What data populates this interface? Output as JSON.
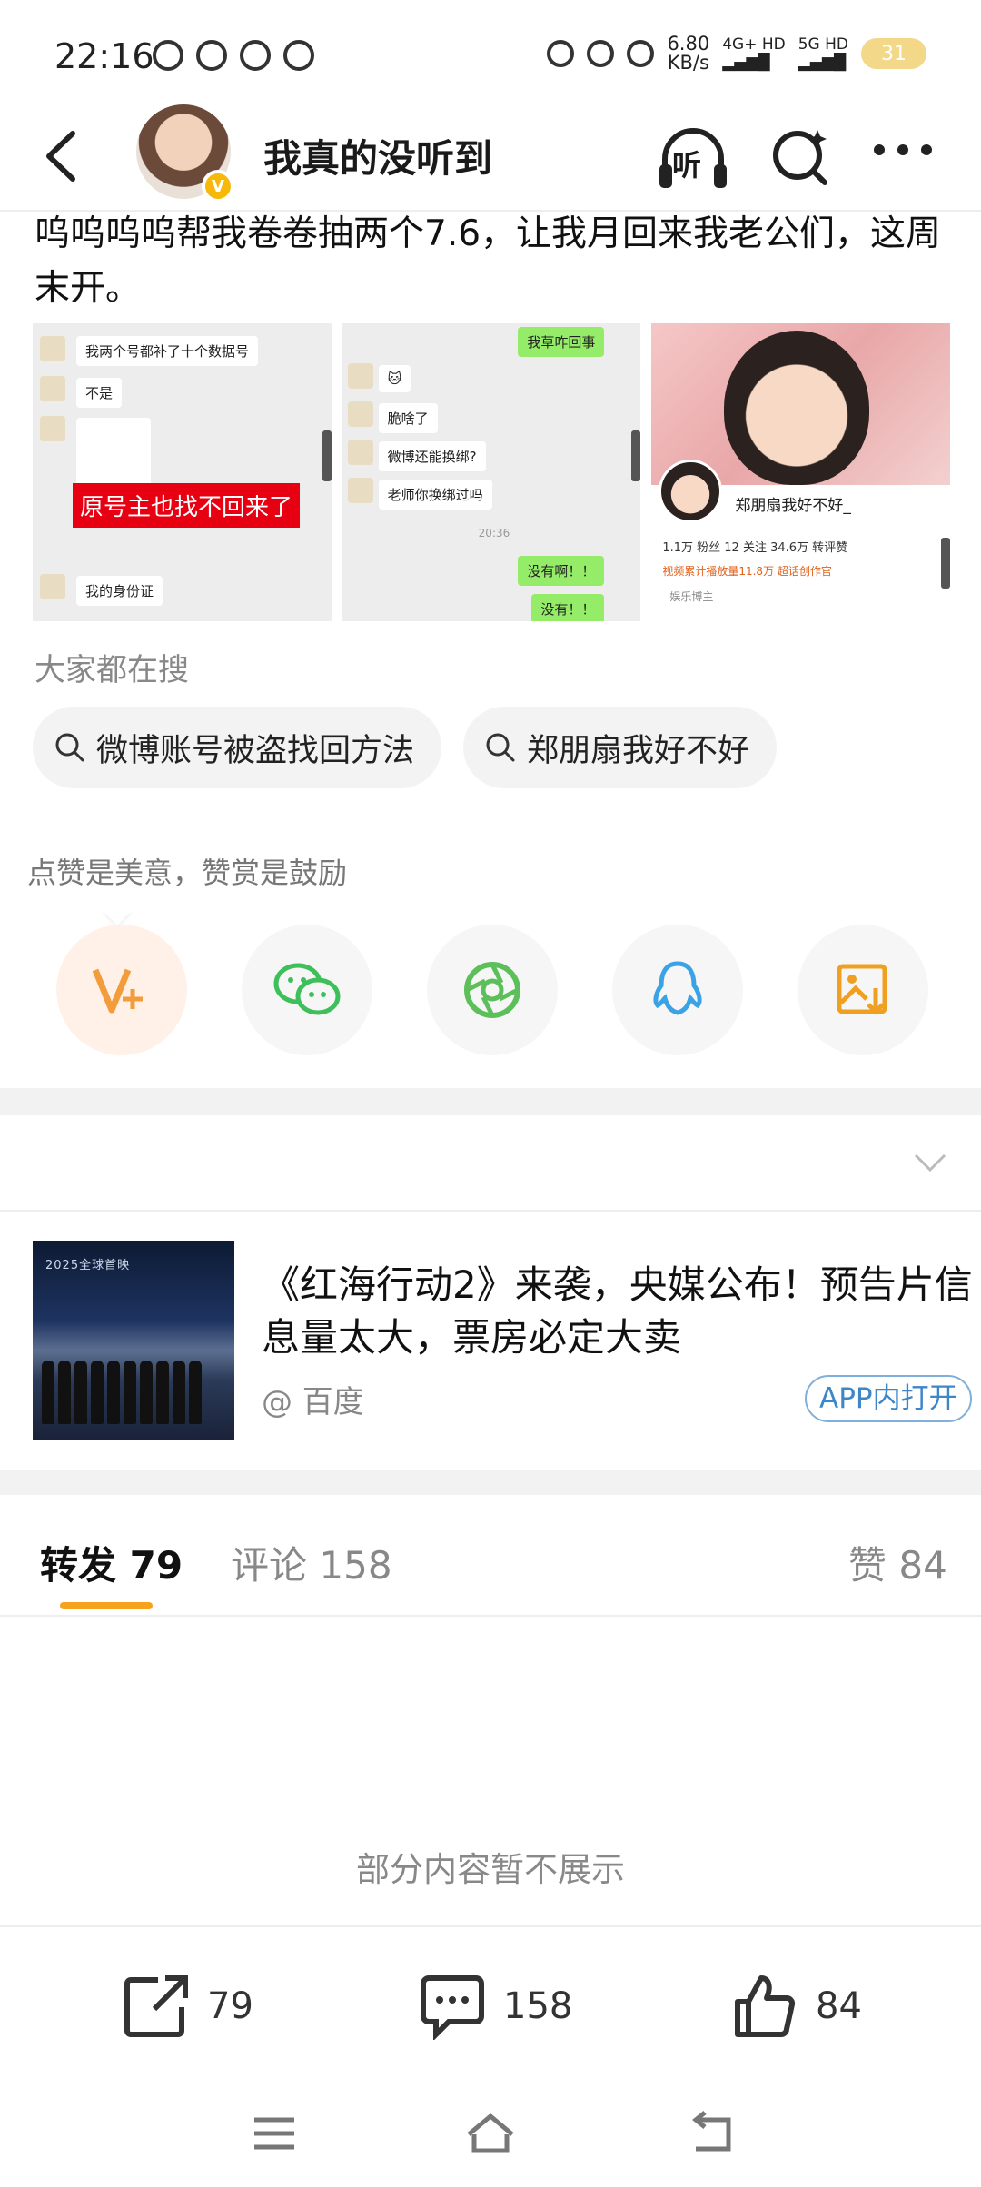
{
  "status_bar": {
    "time": "22:16",
    "speed_value": "6.80",
    "speed_unit": "KB/s",
    "net1": "4G+ HD",
    "net2": "5G HD",
    "battery": "31"
  },
  "header": {
    "username": "我真的没听到",
    "listen_label": "听"
  },
  "post": {
    "text": "呜呜呜呜帮我卷卷抽两个7.6，让我月回来我老公们，这周末开。",
    "images": [
      {
        "bubbles": [
          "我两个号都补了十个数据号",
          "不是",
          "我的身份证"
        ],
        "red_tag": "原号主也找不回来了"
      },
      {
        "bubbles": [
          "我草咋回事",
          "脆啥了",
          "微博还能换绑?",
          "老师你换绑过吗",
          "没有啊！！",
          "没有！！"
        ],
        "time": "20:36"
      },
      {
        "name": "郑朋扇我好不好_",
        "stats": "1.1万 粉丝   12 关注   34.6万 转评赞",
        "tags": "视频累计播放量11.8万   超话创作官",
        "role": "娱乐博主"
      }
    ]
  },
  "search_section": {
    "title": "大家都在搜",
    "chips": [
      "微博账号被盗找回方法",
      "郑朋扇我好不好"
    ]
  },
  "like_hint": "点赞是美意，赞赏是鼓励",
  "share_icons": [
    "v-plus-icon",
    "wechat-icon",
    "moments-icon",
    "qq-icon",
    "save-image-icon"
  ],
  "news": {
    "title": "《红海行动2》来袭，央媒公布！预告片信息量太大，票房必定大卖",
    "source": "@ 百度",
    "open_label": "APP内打开",
    "image_banner": "2025全球首映"
  },
  "tabs": {
    "repost_label": "转发",
    "repost_count": "79",
    "comment_label": "评论",
    "comment_count": "158",
    "like_label": "赞",
    "like_count": "84"
  },
  "hidden_text": "部分内容暂不展示",
  "actions": {
    "repost": "79",
    "comment": "158",
    "like": "84"
  },
  "colors": {
    "accent": "#f6a21c",
    "link": "#3d87c8",
    "wechat": "#3fbf5a",
    "qq": "#3aa3e6",
    "vplus": "#f39c3c"
  }
}
